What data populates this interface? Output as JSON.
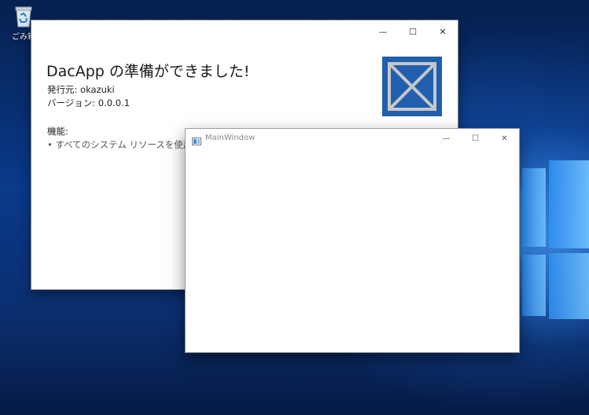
{
  "desktop": {
    "recycle_bin_label": "ごみ箱"
  },
  "installer": {
    "title": "DacApp の準備ができました!",
    "publisher_line": "発行元: okazuki",
    "version_line": "バージョン: 0.0.0.1",
    "features_heading": "機能:",
    "feature_item": "• すべてのシステム リソースを使用する"
  },
  "main_window": {
    "title": "MainWindow"
  },
  "caption": {
    "minimize": "—",
    "maximize": "☐",
    "close": "✕"
  },
  "colors": {
    "logo_bg": "#1f5fae",
    "wallpaper": "#0a3a8a"
  }
}
